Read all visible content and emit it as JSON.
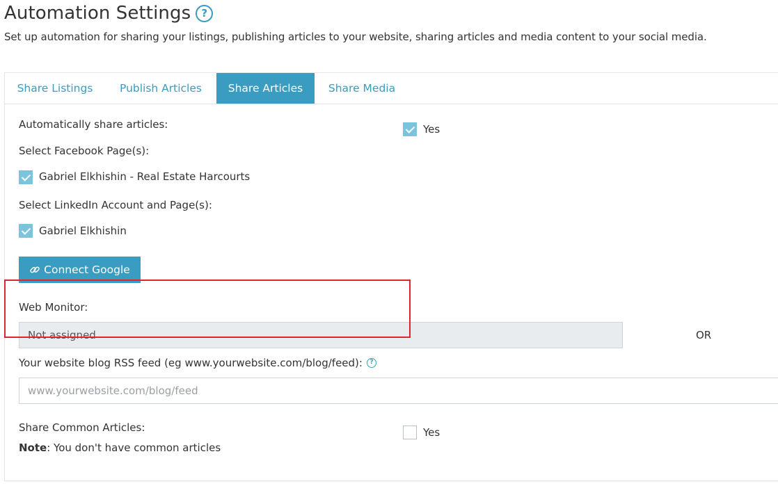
{
  "page": {
    "title": "Automation Settings",
    "help_glyph": "?",
    "subtitle": "Set up automation for sharing your listings, publishing articles to your website, sharing articles and media content to your social media."
  },
  "tabs": [
    {
      "label": "Share Listings",
      "active": false
    },
    {
      "label": "Publish Articles",
      "active": false
    },
    {
      "label": "Share Articles",
      "active": true
    },
    {
      "label": "Share Media",
      "active": false
    }
  ],
  "form": {
    "auto_share_label": "Automatically share articles:",
    "auto_share_option": "Yes",
    "auto_share_checked": true,
    "facebook_label": "Select Facebook Page(s):",
    "facebook_page": "Gabriel Elkhishin - Real Estate Harcourts",
    "facebook_checked": true,
    "linkedin_label": "Select LinkedIn Account and Page(s):",
    "linkedin_account": "Gabriel Elkhishin",
    "linkedin_checked": true,
    "connect_google_label": "Connect Google",
    "web_monitor_label": "Web Monitor:",
    "web_monitor_value": "Not assigned",
    "or_label": "OR",
    "rss_label": "Your website blog RSS feed (eg www.yourwebsite.com/blog/feed):",
    "rss_help_glyph": "?",
    "rss_value": "",
    "rss_placeholder": "www.yourwebsite.com/blog/feed",
    "common_label": "Share Common Articles:",
    "common_option": "Yes",
    "common_checked": false,
    "note_bold": "Note",
    "note_text": ": You don't have common articles"
  },
  "icons": {
    "help": "question-circle-icon",
    "link": "link-icon",
    "check": "checkmark-icon"
  },
  "colors": {
    "accent": "#3a9cc1",
    "checkbox_fill": "#7bc4de",
    "highlight": "#e0242b",
    "readonly_bg": "#e9ecef"
  }
}
